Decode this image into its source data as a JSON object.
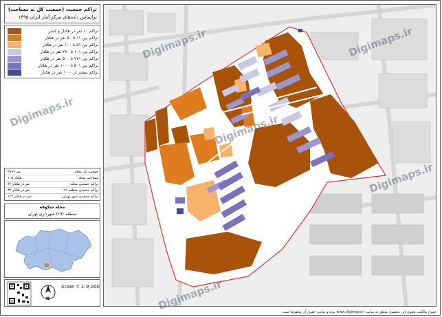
{
  "title": {
    "line1": "تراکم جمعیت (جمعیت کل به مساحت)",
    "line2": "براساس داده‌های مرکز آمار ایران ۱۳۹۵"
  },
  "legend": [
    {
      "label": "تراکم ۱۰ نفر در هکتار و کمتر",
      "color": "#a8520a"
    },
    {
      "label": "تراکم بین ۱۱ تا ۵۰ نفر در هکتار",
      "color": "#e07c1e"
    },
    {
      "label": "تراکم بین ۵۱ تا ۱۰۰ نفر در هکتار",
      "color": "#f7b36b"
    },
    {
      "label": "تراکم بین ۱۰۱ تا ۲۷۰ نفر در هکتار",
      "color": "#c9c9e6"
    },
    {
      "label": "تراکم بین ۲۷۱ تا ۵۰۰ نفر در هکتار",
      "color": "#9a96cf"
    },
    {
      "label": "تراکم بین ۵۰۱ تا ۱۰۰۰ نفر در هکتار",
      "color": "#7a72bf"
    },
    {
      "label": "تراکم بیشتر از ۱۰۰۰ نفر در هکتار",
      "color": "#4d449c"
    }
  ],
  "info": [
    {
      "label": "جمعیت کل محله:",
      "value": "۴۸۹۶ نفر"
    },
    {
      "label": "مساحت محله:",
      "value": "۱۰۵ هکتار"
    },
    {
      "label": "تراکم جمعیتی محله:",
      "value": "۴۶ نفر در هکتار"
    },
    {
      "label": "تراکم جمعیتی منطقه ۱۹:",
      "value": "۳۲ نفر در هکتار"
    },
    {
      "label": "تراکم جمعیتی شهر تهران:",
      "value": "۱۱۴ نفر در هکتار"
    }
  ],
  "location": {
    "name": "محله شکوفه",
    "district": "منطقه (۱۹) شهرداری تهران"
  },
  "scale": "Scale = 1:9,000",
  "north_label": "N",
  "watermarks": [
    "Digimaps.ir",
    "Digimaps.ir",
    "Digimaps.ir",
    "Digimaps.ir",
    "Digimaps.ir",
    "Digimaps.ir"
  ],
  "footer": "حقوق مالکیت معنوی این محصول متعلق به سایت www.digimaps.ir بوده و تمامی حقوق آن محفوظ است.",
  "colors": {
    "boundary": "#e0303a",
    "inset_city": "#a9c4e8",
    "inset_highlight": "#e07c1e"
  }
}
